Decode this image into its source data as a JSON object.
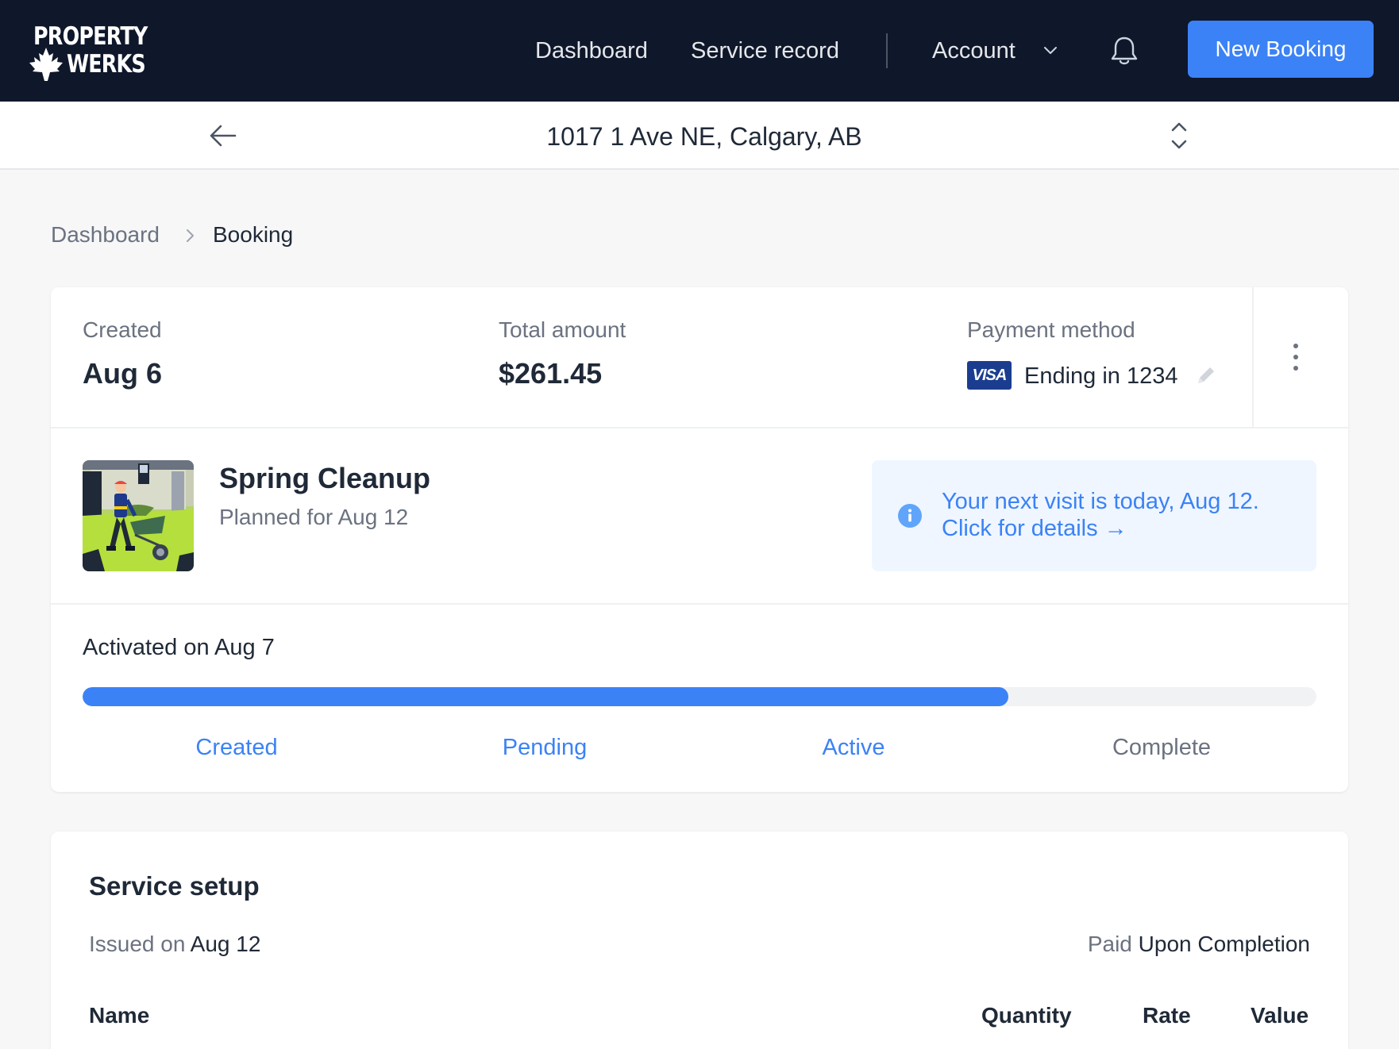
{
  "brand": {
    "line1": "PROPERTY",
    "line2": "WERKS"
  },
  "nav": {
    "dashboard": "Dashboard",
    "service_record": "Service record",
    "account": "Account",
    "new_booking": "New Booking"
  },
  "address_bar": {
    "address": "1017 1 Ave NE, Calgary, AB"
  },
  "breadcrumb": {
    "items": [
      "Dashboard",
      "Booking"
    ]
  },
  "summary": {
    "created_label": "Created",
    "created_value": "Aug 6",
    "total_label": "Total amount",
    "total_value": "$261.45",
    "payment_label": "Payment method",
    "card_brand": "VISA",
    "card_text": "Ending in 1234"
  },
  "service": {
    "title": "Spring Cleanup",
    "subtitle": "Planned for Aug 12"
  },
  "notice": {
    "line1": "Your next visit is today, Aug 12.",
    "line2": "Click for details →"
  },
  "progress": {
    "activated_text": "Activated on Aug 7",
    "fraction": 0.75,
    "steps": [
      {
        "label": "Created",
        "done": true
      },
      {
        "label": "Pending",
        "done": true
      },
      {
        "label": "Active",
        "done": true
      },
      {
        "label": "Complete",
        "done": false
      }
    ]
  },
  "service_setup": {
    "title": "Service setup",
    "issued_prefix": "Issued on",
    "issued_value": "Aug 12",
    "paid_prefix": "Paid",
    "paid_value": "Upon Completion",
    "columns": [
      "Name",
      "Quantity",
      "Rate",
      "Value"
    ]
  },
  "colors": {
    "nav_bg": "#0f172a",
    "accent": "#3b82f6",
    "notice_bg": "#eff6ff",
    "muted_text": "#6b7280",
    "step_inactive": "#6b7280"
  },
  "icons": {
    "logo": "maple-leaf-icon",
    "account_menu": "chevron-down-icon",
    "notifications": "bell-icon",
    "back": "arrow-left-icon",
    "switch_property": "chevron-up-down-icon",
    "breadcrumb_separator": "chevron-right-icon",
    "edit_payment": "pencil-icon",
    "more": "more-vertical-icon",
    "notice": "info-icon"
  }
}
